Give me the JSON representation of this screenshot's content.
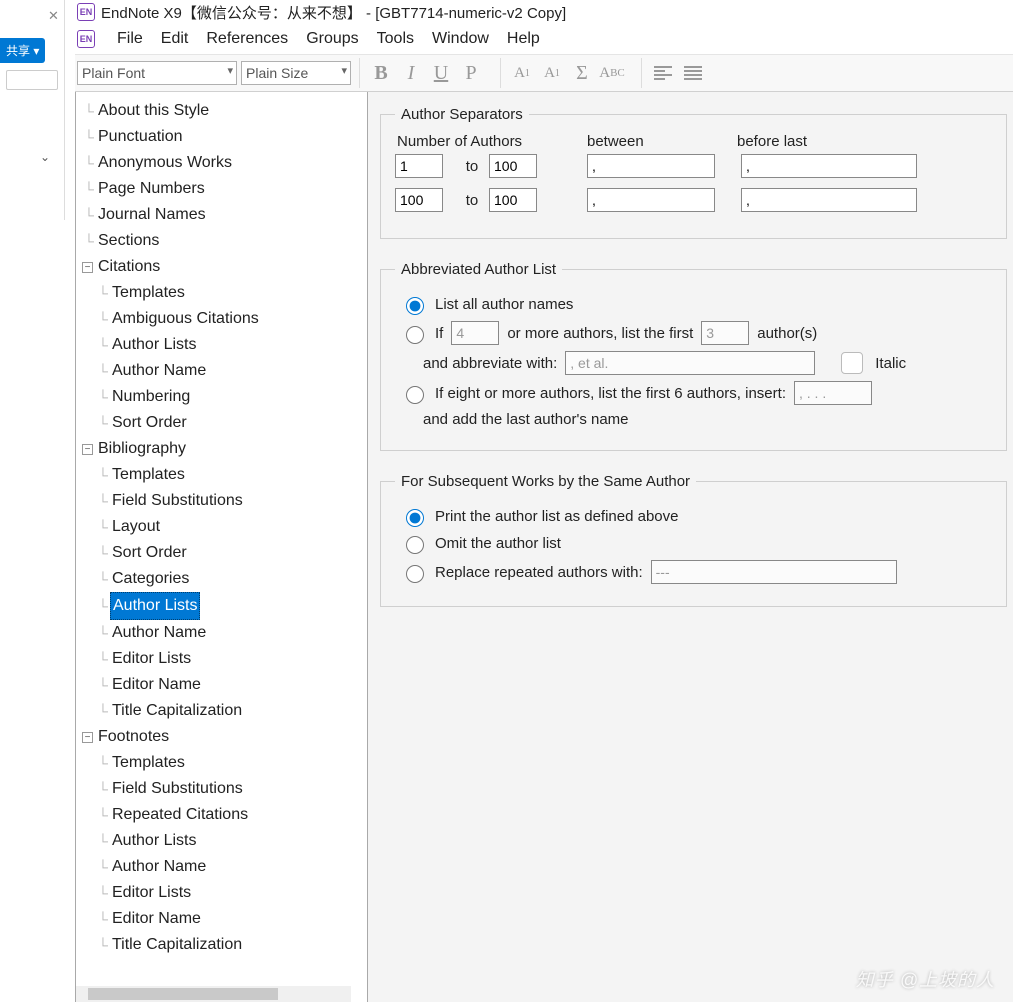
{
  "title": "EndNote X9【微信公众号：从来不想】 - [GBT7714-numeric-v2 Copy]",
  "menus": [
    "File",
    "Edit",
    "References",
    "Groups",
    "Tools",
    "Window",
    "Help"
  ],
  "share_label": "共享",
  "font_select": "Plain Font",
  "size_select": "Plain Size",
  "tree": {
    "items": [
      {
        "label": "About this Style",
        "lvl": 1
      },
      {
        "label": "Punctuation",
        "lvl": 1
      },
      {
        "label": "Anonymous Works",
        "lvl": 1
      },
      {
        "label": "Page Numbers",
        "lvl": 1
      },
      {
        "label": "Journal Names",
        "lvl": 1
      },
      {
        "label": "Sections",
        "lvl": 1
      },
      {
        "label": "Citations",
        "lvl": 0,
        "exp": "−"
      },
      {
        "label": "Templates",
        "lvl": 2
      },
      {
        "label": "Ambiguous Citations",
        "lvl": 2
      },
      {
        "label": "Author Lists",
        "lvl": 2
      },
      {
        "label": "Author Name",
        "lvl": 2
      },
      {
        "label": "Numbering",
        "lvl": 2
      },
      {
        "label": "Sort Order",
        "lvl": 2
      },
      {
        "label": "Bibliography",
        "lvl": 0,
        "exp": "−"
      },
      {
        "label": "Templates",
        "lvl": 2
      },
      {
        "label": "Field Substitutions",
        "lvl": 2
      },
      {
        "label": "Layout",
        "lvl": 2
      },
      {
        "label": "Sort Order",
        "lvl": 2
      },
      {
        "label": "Categories",
        "lvl": 2
      },
      {
        "label": "Author Lists",
        "lvl": 2,
        "selected": true
      },
      {
        "label": "Author Name",
        "lvl": 2
      },
      {
        "label": "Editor Lists",
        "lvl": 2
      },
      {
        "label": "Editor Name",
        "lvl": 2
      },
      {
        "label": "Title Capitalization",
        "lvl": 2
      },
      {
        "label": "Footnotes",
        "lvl": 0,
        "exp": "−"
      },
      {
        "label": "Templates",
        "lvl": 2
      },
      {
        "label": "Field Substitutions",
        "lvl": 2
      },
      {
        "label": "Repeated Citations",
        "lvl": 2
      },
      {
        "label": "Author Lists",
        "lvl": 2
      },
      {
        "label": "Author Name",
        "lvl": 2
      },
      {
        "label": "Editor Lists",
        "lvl": 2
      },
      {
        "label": "Editor Name",
        "lvl": 2
      },
      {
        "label": "Title Capitalization",
        "lvl": 2
      }
    ]
  },
  "author_sep": {
    "legend": "Author Separators",
    "head_num": "Number of Authors",
    "head_between": "between",
    "head_before": "before last",
    "row1": {
      "from": "1",
      "to_label": "to",
      "to": "100",
      "between": ",",
      "before": ","
    },
    "row2": {
      "from": "100",
      "to_label": "to",
      "to": "100",
      "between": ",",
      "before": ","
    }
  },
  "abbrev": {
    "legend": "Abbreviated Author List",
    "opt_all": "List all author names",
    "opt_if": "If",
    "opt_if_n1": "4",
    "opt_if_mid": "or more authors, list the first",
    "opt_if_n2": "3",
    "opt_if_tail": "author(s)",
    "abbrev_with": "and abbreviate with:",
    "abbrev_val": ", et al.",
    "italic": "Italic",
    "opt_eight": "If eight or more authors, list the first 6 authors, insert:",
    "opt_eight_val": ", . . .",
    "opt_eight_tail": "and add the last author's name"
  },
  "subseq": {
    "legend": "For Subsequent Works by the Same Author",
    "opt_print": "Print the author list as defined above",
    "opt_omit": "Omit the author list",
    "opt_replace": "Replace repeated authors with:",
    "replace_val": "---"
  },
  "watermark": "知乎 @上坡的人"
}
